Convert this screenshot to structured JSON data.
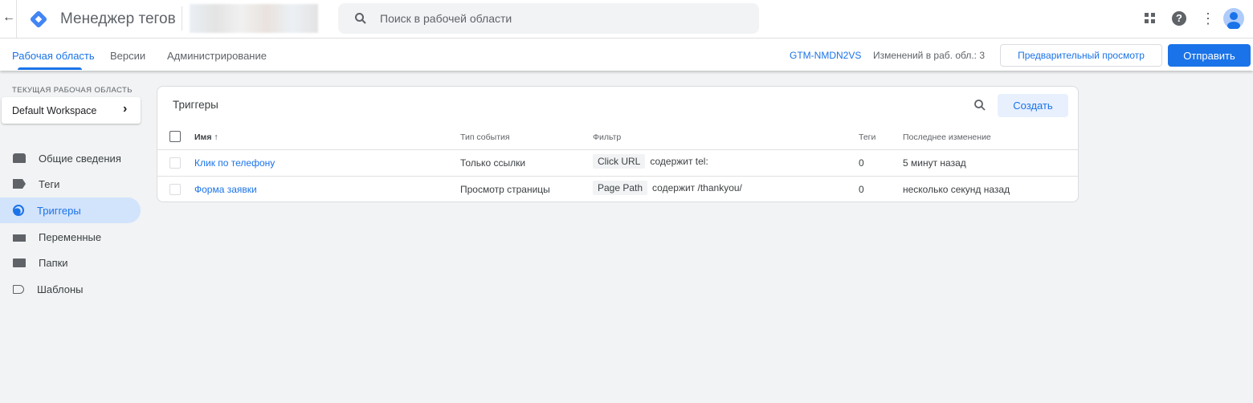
{
  "header": {
    "app_title": "Менеджер тегов",
    "search_placeholder": "Поиск в рабочей области"
  },
  "tabs": [
    {
      "label": "Рабочая область"
    },
    {
      "label": "Версии"
    },
    {
      "label": "Администрирование"
    }
  ],
  "container_id": "GTM-NMDN2VS",
  "changes": "Изменений в раб. обл.: 3",
  "preview_label": "Предварительный просмотр",
  "submit_label": "Отправить",
  "sidebar": {
    "workspace_label": "ТЕКУЩАЯ РАБОЧАЯ ОБЛАСТЬ",
    "workspace_name": "Default Workspace",
    "items": [
      {
        "label": "Общие сведения"
      },
      {
        "label": "Теги"
      },
      {
        "label": "Триггеры"
      },
      {
        "label": "Переменные"
      },
      {
        "label": "Папки"
      },
      {
        "label": "Шаблоны"
      }
    ]
  },
  "card": {
    "title": "Триггеры",
    "create_label": "Создать",
    "columns": {
      "name": "Имя",
      "type": "Тип события",
      "filter": "Фильтр",
      "tags": "Теги",
      "modified": "Последнее изменение"
    },
    "rows": [
      {
        "name": "Клик по телефону",
        "type": "Только ссылки",
        "filter_var": "Click URL",
        "filter_cond": "содержит tel:",
        "tags": "0",
        "modified": "5 минут назад"
      },
      {
        "name": "Форма заявки",
        "type": "Просмотр страницы",
        "filter_var": "Page Path",
        "filter_cond": "содержит /thankyou/",
        "tags": "0",
        "modified": "несколько секунд назад"
      }
    ]
  },
  "colors": {
    "accent": "#1a73e8",
    "active_nav": "#d2e3fc"
  }
}
